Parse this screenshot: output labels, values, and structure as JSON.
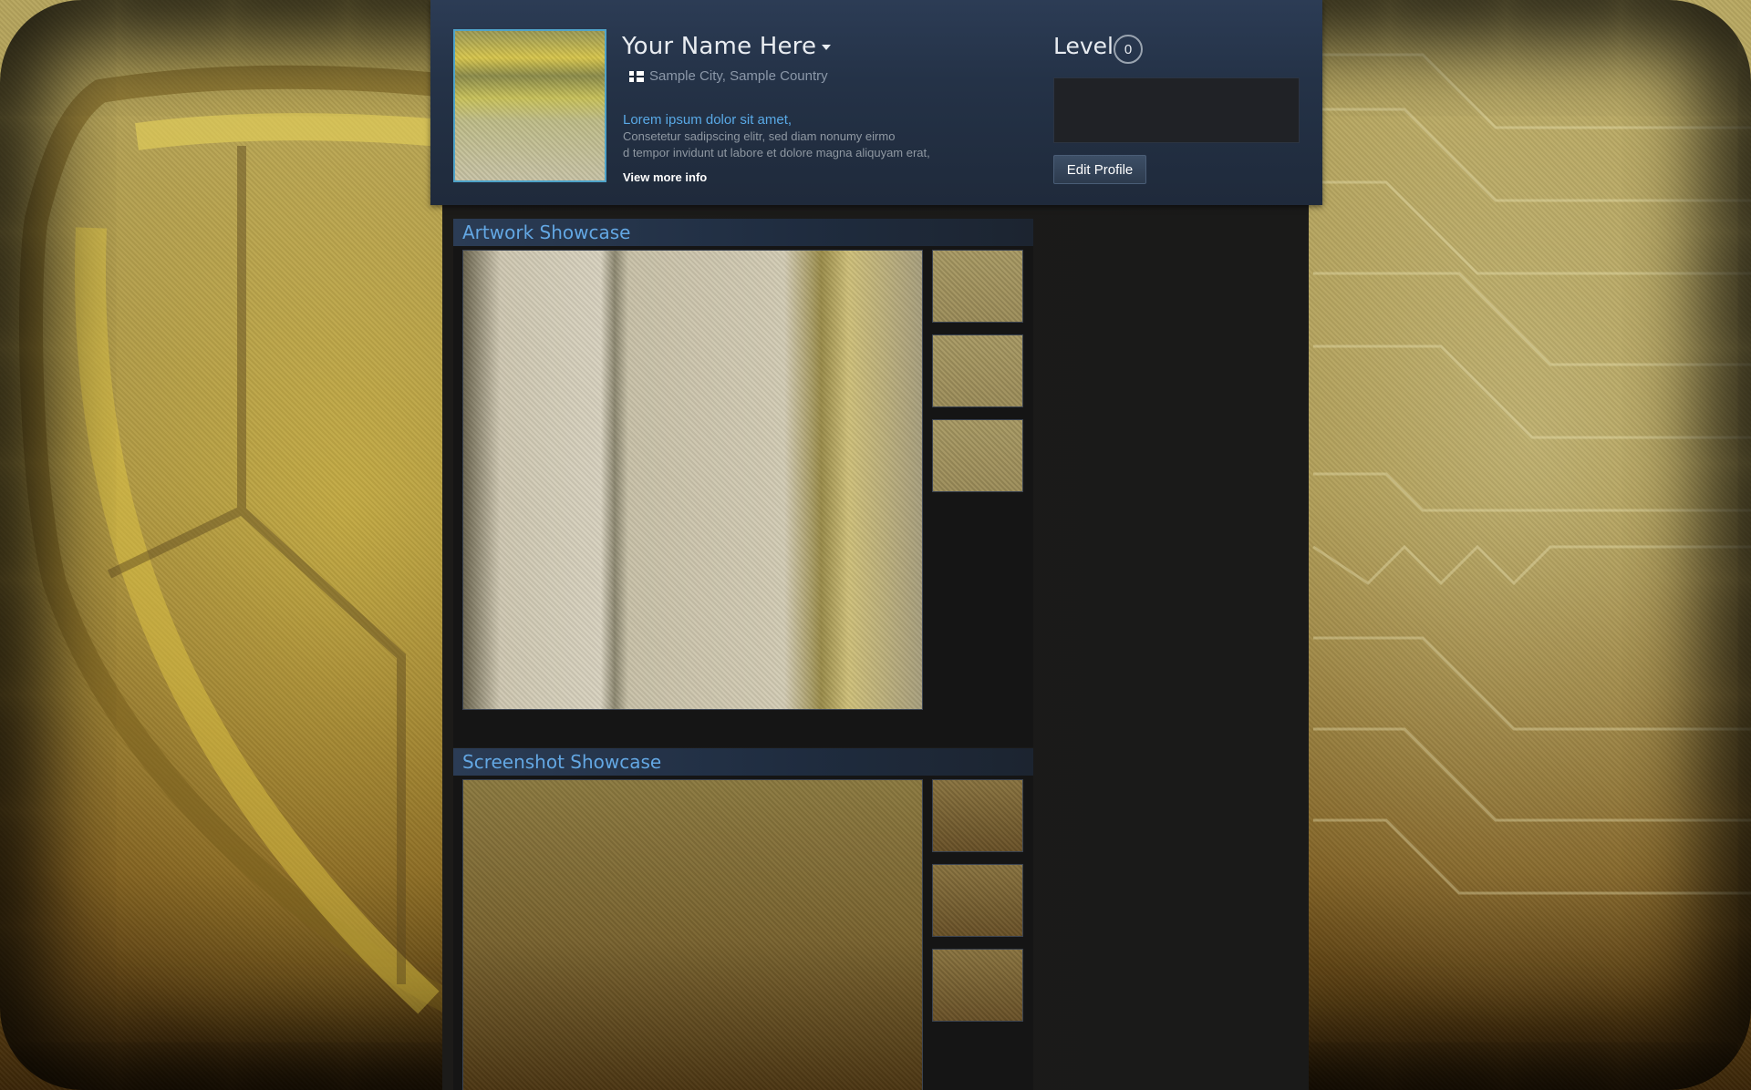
{
  "profile": {
    "persona_name": "Your Name Here",
    "location": "Sample City, Sample Country",
    "summary": {
      "title": "Lorem ipsum dolor sit amet,",
      "line1": "Consetetur sadipscing elitr, sed diam nonumy eirmo",
      "line2": "d tempor invidunt ut labore et dolore magna aliquyam erat,"
    },
    "view_more": "View more info",
    "level_label": "Level",
    "level_value": "0",
    "edit_button": "Edit Profile"
  },
  "showcases": {
    "artwork_title": "Artwork Showcase",
    "screenshot_title": "Screenshot Showcase"
  },
  "colors": {
    "header_bg": "#243247",
    "accent_blue": "#59a9e6",
    "showcase_title": "#63a7e3",
    "avatar_border": "#4fa3c9"
  },
  "icons": {
    "dropdown": "chevron-down-icon",
    "flag": "country-flag-icon"
  }
}
